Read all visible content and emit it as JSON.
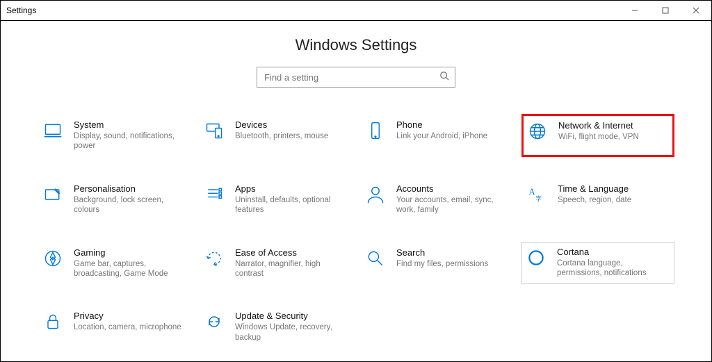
{
  "window": {
    "title": "Settings"
  },
  "header": {
    "title": "Windows Settings"
  },
  "search": {
    "placeholder": "Find a setting"
  },
  "cards": {
    "system": {
      "title": "System",
      "desc": "Display, sound, notifications, power"
    },
    "devices": {
      "title": "Devices",
      "desc": "Bluetooth, printers, mouse"
    },
    "phone": {
      "title": "Phone",
      "desc": "Link your Android, iPhone"
    },
    "network": {
      "title": "Network & Internet",
      "desc": "WiFi, flight mode, VPN"
    },
    "personalisation": {
      "title": "Personalisation",
      "desc": "Background, lock screen, colours"
    },
    "apps": {
      "title": "Apps",
      "desc": "Uninstall, defaults, optional features"
    },
    "accounts": {
      "title": "Accounts",
      "desc": "Your accounts, email, sync, work, family"
    },
    "time": {
      "title": "Time & Language",
      "desc": "Speech, region, date"
    },
    "gaming": {
      "title": "Gaming",
      "desc": "Game bar, captures, broadcasting, Game Mode"
    },
    "ease": {
      "title": "Ease of Access",
      "desc": "Narrator, magnifier, high contrast"
    },
    "search_cat": {
      "title": "Search",
      "desc": "Find my files, permissions"
    },
    "cortana": {
      "title": "Cortana",
      "desc": "Cortana language, permissions, notifications"
    },
    "privacy": {
      "title": "Privacy",
      "desc": "Location, camera, microphone"
    },
    "update": {
      "title": "Update & Security",
      "desc": "Windows Update, recovery, backup"
    }
  }
}
